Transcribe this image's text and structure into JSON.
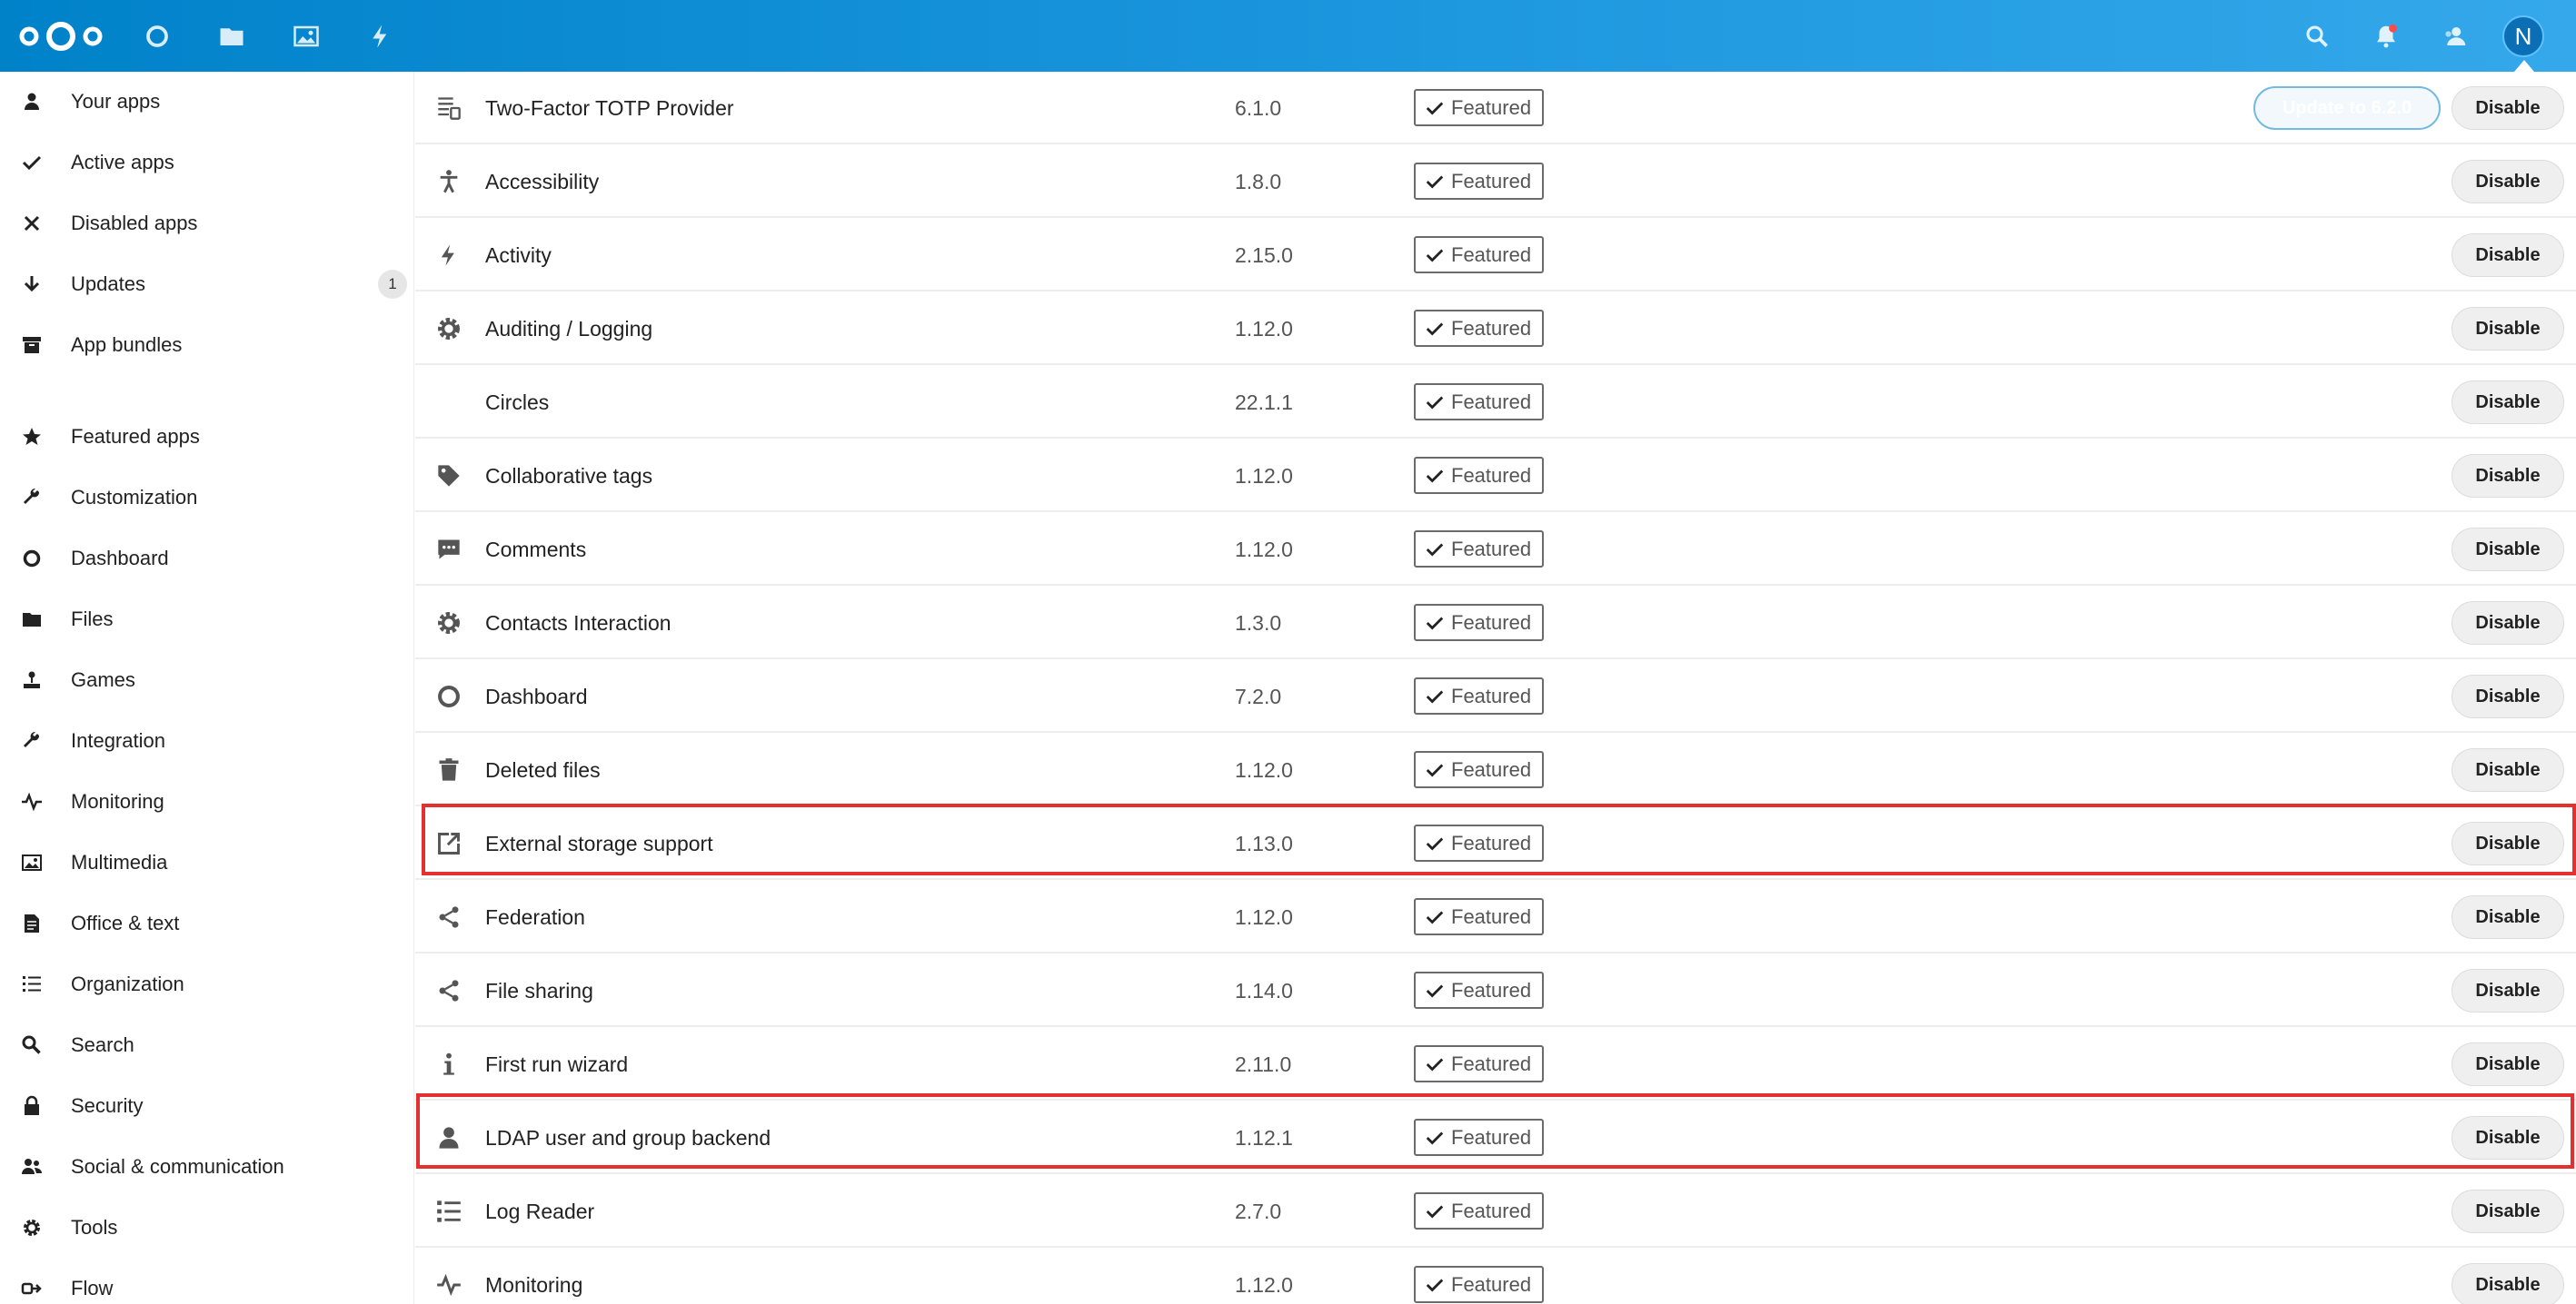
{
  "header": {
    "icons": [
      "dashboard-icon",
      "files-icon",
      "photos-icon",
      "activity-icon"
    ],
    "right_icons": [
      "search-icon",
      "notifications-icon",
      "contacts-icon"
    ],
    "avatar_initial": "N",
    "brand_color": "#0082c9"
  },
  "sidebar": {
    "items": [
      {
        "label": "Your apps",
        "icon": "user-icon"
      },
      {
        "label": "Active apps",
        "icon": "check-icon"
      },
      {
        "label": "Disabled apps",
        "icon": "close-icon"
      },
      {
        "label": "Updates",
        "icon": "download-icon",
        "badge": "1"
      },
      {
        "label": "App bundles",
        "icon": "archive-icon"
      },
      {
        "label": "Featured apps",
        "icon": "star-icon"
      },
      {
        "label": "Customization",
        "icon": "wrench-icon"
      },
      {
        "label": "Dashboard",
        "icon": "circle-icon"
      },
      {
        "label": "Files",
        "icon": "folder-icon"
      },
      {
        "label": "Games",
        "icon": "joystick-icon"
      },
      {
        "label": "Integration",
        "icon": "wrench-icon"
      },
      {
        "label": "Monitoring",
        "icon": "pulse-icon"
      },
      {
        "label": "Multimedia",
        "icon": "image-icon"
      },
      {
        "label": "Office & text",
        "icon": "document-icon"
      },
      {
        "label": "Organization",
        "icon": "list-icon"
      },
      {
        "label": "Search",
        "icon": "search-icon"
      },
      {
        "label": "Security",
        "icon": "lock-icon"
      },
      {
        "label": "Social & communication",
        "icon": "people-icon"
      },
      {
        "label": "Tools",
        "icon": "gear-icon"
      },
      {
        "label": "Flow",
        "icon": "flow-icon"
      }
    ]
  },
  "apps": {
    "featured_label": "Featured",
    "disable_label": "Disable",
    "update_label": "Update to 6.2.0",
    "rows": [
      {
        "name": "Two-Factor TOTP Provider",
        "version": "6.1.0",
        "icon": "totp-icon"
      },
      {
        "name": "Accessibility",
        "version": "1.8.0",
        "icon": "accessibility-icon"
      },
      {
        "name": "Activity",
        "version": "2.15.0",
        "icon": "activity-icon"
      },
      {
        "name": "Auditing / Logging",
        "version": "1.12.0",
        "icon": "gear-icon"
      },
      {
        "name": "Circles",
        "version": "22.1.1",
        "icon": ""
      },
      {
        "name": "Collaborative tags",
        "version": "1.12.0",
        "icon": "tag-icon"
      },
      {
        "name": "Comments",
        "version": "1.12.0",
        "icon": "comment-icon"
      },
      {
        "name": "Contacts Interaction",
        "version": "1.3.0",
        "icon": "gear-icon"
      },
      {
        "name": "Dashboard",
        "version": "7.2.0",
        "icon": "circle-icon"
      },
      {
        "name": "Deleted files",
        "version": "1.12.0",
        "icon": "trash-icon"
      },
      {
        "name": "External storage support",
        "version": "1.13.0",
        "icon": "external-icon"
      },
      {
        "name": "Federation",
        "version": "1.12.0",
        "icon": "share-icon"
      },
      {
        "name": "File sharing",
        "version": "1.14.0",
        "icon": "share-icon"
      },
      {
        "name": "First run wizard",
        "version": "2.11.0",
        "icon": "info-icon"
      },
      {
        "name": "LDAP user and group backend",
        "version": "1.12.1",
        "icon": "user-icon"
      },
      {
        "name": "Log Reader",
        "version": "2.7.0",
        "icon": "list-icon"
      },
      {
        "name": "Monitoring",
        "version": "1.12.0",
        "icon": "pulse-icon"
      }
    ]
  },
  "highlight_color": "#e53030"
}
